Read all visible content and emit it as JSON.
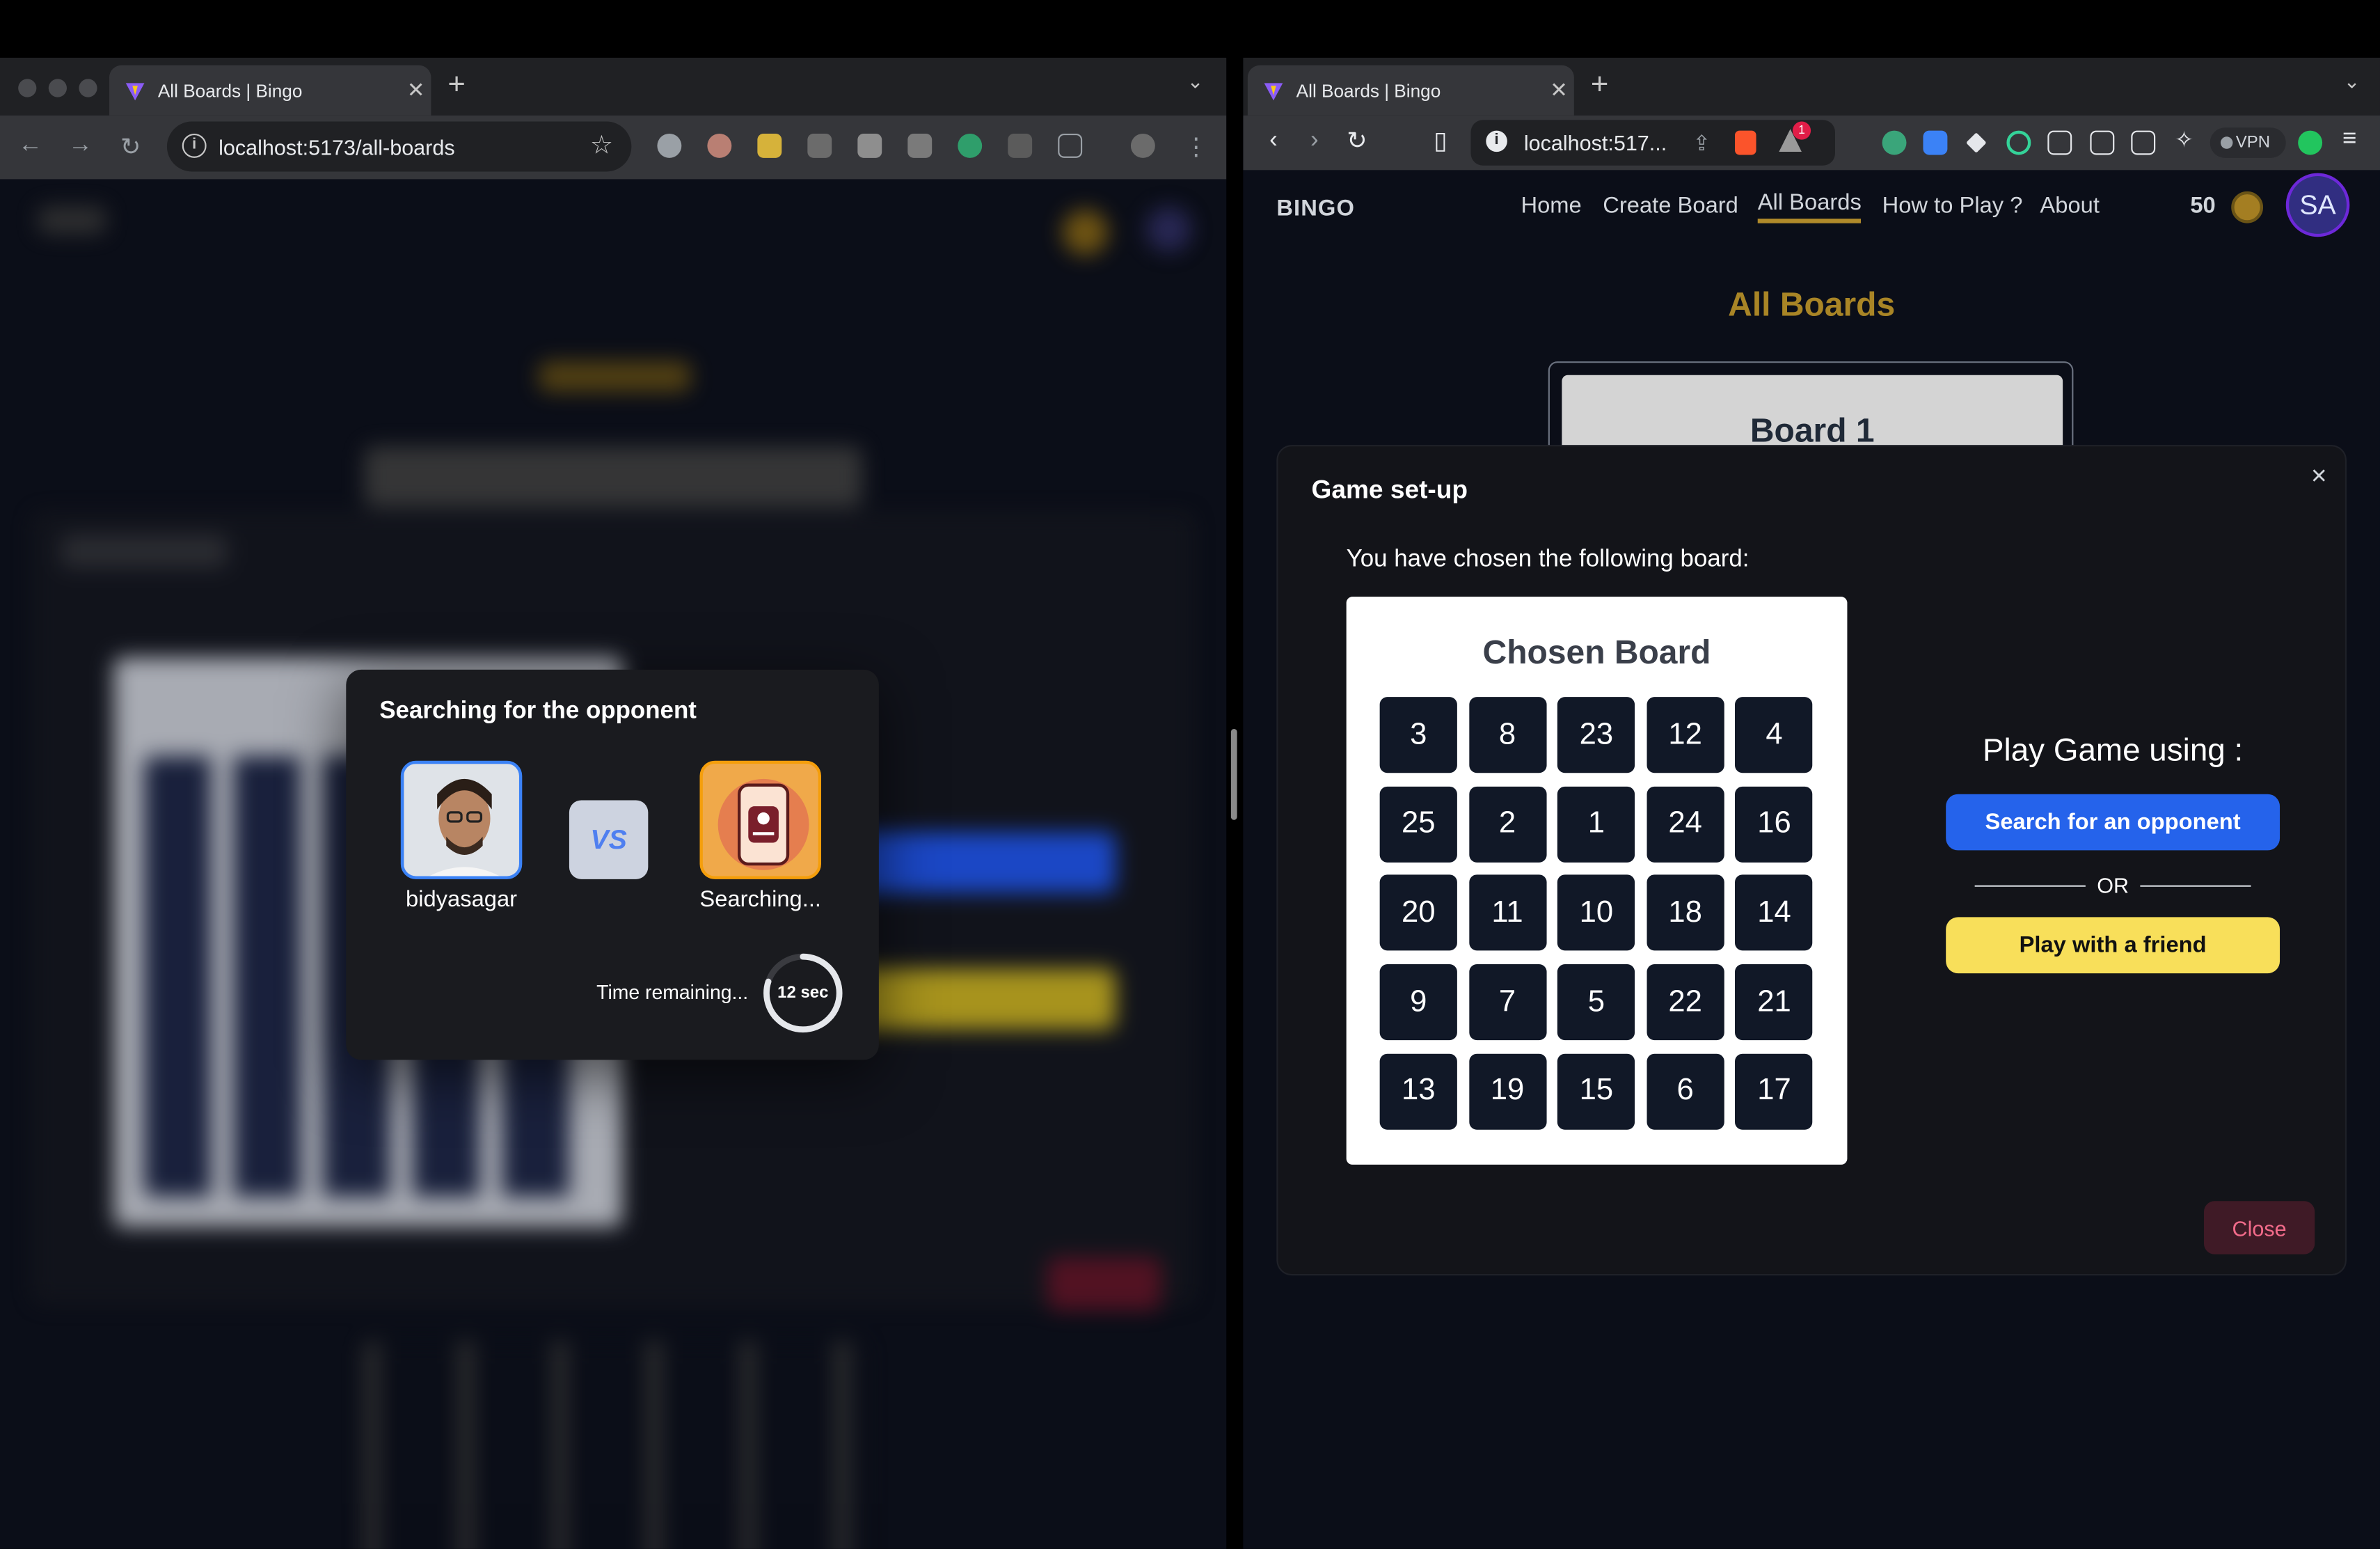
{
  "left_browser": {
    "tab_title": "All Boards | Bingo",
    "url": "localhost:5173/all-boards",
    "search_modal": {
      "title": "Searching for the opponent",
      "player_name": "bidyasagar",
      "vs_label": "VS",
      "opponent_status": "Searching...",
      "time_label": "Time remaining...",
      "timer_text": "12 sec",
      "timer_fraction": 0.8
    }
  },
  "right_browser": {
    "tab_title": "All Boards | Bingo",
    "url": "localhost:517...",
    "vpn_label": "VPN",
    "notification_badge": "1",
    "nav": {
      "logo": "BINGO",
      "links": [
        "Home",
        "Create Board",
        "All Boards",
        "How to Play ?",
        "About"
      ],
      "active": "All Boards",
      "coins": "50",
      "avatar_initials": "SA"
    },
    "page_title": "All Boards",
    "board_card_title": "Board 1",
    "setup_modal": {
      "title": "Game set-up",
      "close_x": "×",
      "subtitle": "You have chosen the following board:",
      "board_title": "Chosen Board",
      "board_numbers": [
        3,
        8,
        23,
        12,
        4,
        25,
        2,
        1,
        24,
        16,
        20,
        11,
        10,
        18,
        14,
        9,
        7,
        5,
        22,
        21,
        13,
        19,
        15,
        6,
        17
      ],
      "play_label": "Play Game using :",
      "search_button": "Search for an opponent",
      "or_label": "OR",
      "friend_button": "Play with a friend",
      "close_button": "Close"
    }
  },
  "colors": {
    "accent_gold": "#a98526",
    "primary_blue": "#2563eb",
    "friend_yellow": "#f8df5a",
    "close_red": "#f26b8a"
  }
}
